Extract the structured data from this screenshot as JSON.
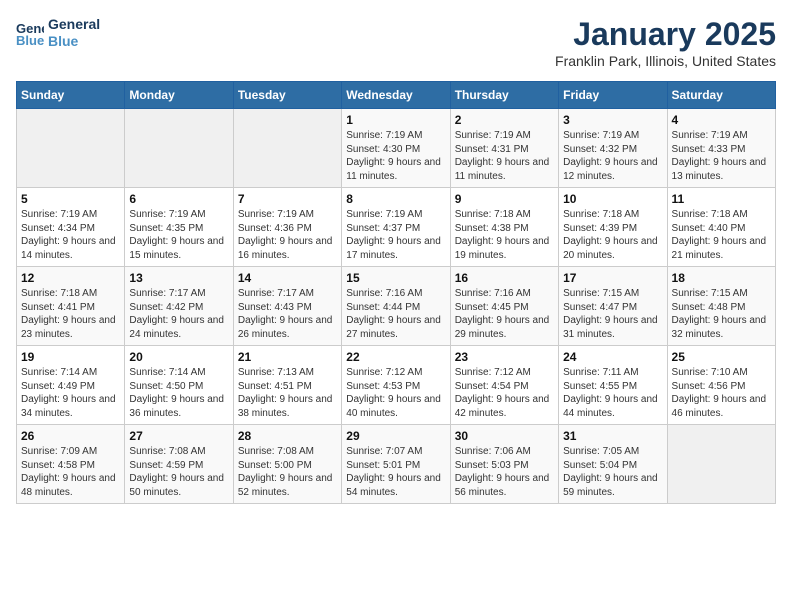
{
  "header": {
    "logo_line1": "General",
    "logo_line2": "Blue",
    "title": "January 2025",
    "subtitle": "Franklin Park, Illinois, United States"
  },
  "days_of_week": [
    "Sunday",
    "Monday",
    "Tuesday",
    "Wednesday",
    "Thursday",
    "Friday",
    "Saturday"
  ],
  "weeks": [
    [
      {
        "day": "",
        "info": ""
      },
      {
        "day": "",
        "info": ""
      },
      {
        "day": "",
        "info": ""
      },
      {
        "day": "1",
        "info": "Sunrise: 7:19 AM\nSunset: 4:30 PM\nDaylight: 9 hours and 11 minutes."
      },
      {
        "day": "2",
        "info": "Sunrise: 7:19 AM\nSunset: 4:31 PM\nDaylight: 9 hours and 11 minutes."
      },
      {
        "day": "3",
        "info": "Sunrise: 7:19 AM\nSunset: 4:32 PM\nDaylight: 9 hours and 12 minutes."
      },
      {
        "day": "4",
        "info": "Sunrise: 7:19 AM\nSunset: 4:33 PM\nDaylight: 9 hours and 13 minutes."
      }
    ],
    [
      {
        "day": "5",
        "info": "Sunrise: 7:19 AM\nSunset: 4:34 PM\nDaylight: 9 hours and 14 minutes."
      },
      {
        "day": "6",
        "info": "Sunrise: 7:19 AM\nSunset: 4:35 PM\nDaylight: 9 hours and 15 minutes."
      },
      {
        "day": "7",
        "info": "Sunrise: 7:19 AM\nSunset: 4:36 PM\nDaylight: 9 hours and 16 minutes."
      },
      {
        "day": "8",
        "info": "Sunrise: 7:19 AM\nSunset: 4:37 PM\nDaylight: 9 hours and 17 minutes."
      },
      {
        "day": "9",
        "info": "Sunrise: 7:18 AM\nSunset: 4:38 PM\nDaylight: 9 hours and 19 minutes."
      },
      {
        "day": "10",
        "info": "Sunrise: 7:18 AM\nSunset: 4:39 PM\nDaylight: 9 hours and 20 minutes."
      },
      {
        "day": "11",
        "info": "Sunrise: 7:18 AM\nSunset: 4:40 PM\nDaylight: 9 hours and 21 minutes."
      }
    ],
    [
      {
        "day": "12",
        "info": "Sunrise: 7:18 AM\nSunset: 4:41 PM\nDaylight: 9 hours and 23 minutes."
      },
      {
        "day": "13",
        "info": "Sunrise: 7:17 AM\nSunset: 4:42 PM\nDaylight: 9 hours and 24 minutes."
      },
      {
        "day": "14",
        "info": "Sunrise: 7:17 AM\nSunset: 4:43 PM\nDaylight: 9 hours and 26 minutes."
      },
      {
        "day": "15",
        "info": "Sunrise: 7:16 AM\nSunset: 4:44 PM\nDaylight: 9 hours and 27 minutes."
      },
      {
        "day": "16",
        "info": "Sunrise: 7:16 AM\nSunset: 4:45 PM\nDaylight: 9 hours and 29 minutes."
      },
      {
        "day": "17",
        "info": "Sunrise: 7:15 AM\nSunset: 4:47 PM\nDaylight: 9 hours and 31 minutes."
      },
      {
        "day": "18",
        "info": "Sunrise: 7:15 AM\nSunset: 4:48 PM\nDaylight: 9 hours and 32 minutes."
      }
    ],
    [
      {
        "day": "19",
        "info": "Sunrise: 7:14 AM\nSunset: 4:49 PM\nDaylight: 9 hours and 34 minutes."
      },
      {
        "day": "20",
        "info": "Sunrise: 7:14 AM\nSunset: 4:50 PM\nDaylight: 9 hours and 36 minutes."
      },
      {
        "day": "21",
        "info": "Sunrise: 7:13 AM\nSunset: 4:51 PM\nDaylight: 9 hours and 38 minutes."
      },
      {
        "day": "22",
        "info": "Sunrise: 7:12 AM\nSunset: 4:53 PM\nDaylight: 9 hours and 40 minutes."
      },
      {
        "day": "23",
        "info": "Sunrise: 7:12 AM\nSunset: 4:54 PM\nDaylight: 9 hours and 42 minutes."
      },
      {
        "day": "24",
        "info": "Sunrise: 7:11 AM\nSunset: 4:55 PM\nDaylight: 9 hours and 44 minutes."
      },
      {
        "day": "25",
        "info": "Sunrise: 7:10 AM\nSunset: 4:56 PM\nDaylight: 9 hours and 46 minutes."
      }
    ],
    [
      {
        "day": "26",
        "info": "Sunrise: 7:09 AM\nSunset: 4:58 PM\nDaylight: 9 hours and 48 minutes."
      },
      {
        "day": "27",
        "info": "Sunrise: 7:08 AM\nSunset: 4:59 PM\nDaylight: 9 hours and 50 minutes."
      },
      {
        "day": "28",
        "info": "Sunrise: 7:08 AM\nSunset: 5:00 PM\nDaylight: 9 hours and 52 minutes."
      },
      {
        "day": "29",
        "info": "Sunrise: 7:07 AM\nSunset: 5:01 PM\nDaylight: 9 hours and 54 minutes."
      },
      {
        "day": "30",
        "info": "Sunrise: 7:06 AM\nSunset: 5:03 PM\nDaylight: 9 hours and 56 minutes."
      },
      {
        "day": "31",
        "info": "Sunrise: 7:05 AM\nSunset: 5:04 PM\nDaylight: 9 hours and 59 minutes."
      },
      {
        "day": "",
        "info": ""
      }
    ]
  ]
}
